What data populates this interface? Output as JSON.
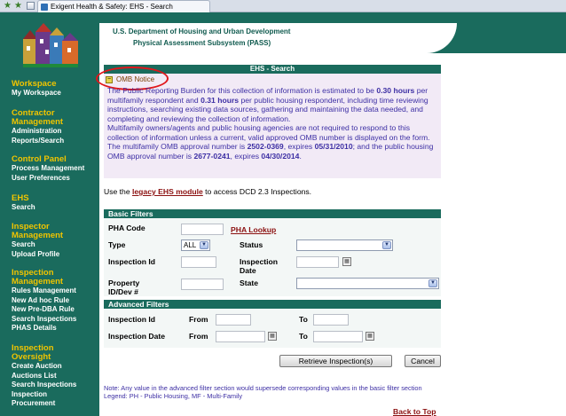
{
  "browser": {
    "tab_title": "Exigent Health & Safety: EHS - Search"
  },
  "header": {
    "line1": "U.S. Department of Housing and Urban Development",
    "line2": "Physical Assessment Subsystem (PASS)"
  },
  "sidebar": {
    "sections": [
      {
        "heading": "Workspace",
        "links": [
          "My Workspace"
        ]
      },
      {
        "heading": "Contractor Management",
        "links": [
          "Administration",
          "Reports/Search"
        ]
      },
      {
        "heading": "Control Panel",
        "links": [
          "Process Management",
          "User Preferences"
        ]
      },
      {
        "heading": "EHS",
        "links": [
          "Search"
        ]
      },
      {
        "heading": "Inspector Management",
        "links": [
          "Search",
          "Upload Profile"
        ]
      },
      {
        "heading": "Inspection Management",
        "links": [
          "Rules Management",
          "New Ad hoc Rule",
          "New Pre-DBA Rule",
          "Search Inspections",
          "PHAS Details"
        ]
      },
      {
        "heading": "Inspection Oversight",
        "links": [
          "Create Auction",
          "Auctions List",
          "Search Inspections",
          "Inspection Procurement"
        ]
      }
    ]
  },
  "page": {
    "title": "EHS - Search",
    "omb_toggle": "−",
    "omb_label": "OMB Notice",
    "omb": {
      "p1_a": "The Public Reporting Burden for this collection of information is estimated to be ",
      "p1_b": "0.30 hours",
      "p1_c": " per multifamily respondent and ",
      "p1_d": "0.31 hours",
      "p1_e": " per public housing respondent, including time reviewing instructions, searching existing data sources, gathering and maintaining the data needed, and completing and reviewing the collection of information.",
      "p2_a": "Multifamily owners/agents and public housing agencies are not required to respond to this collection of information unless a current, valid approved OMB number is displayed on the form. The multifamily OMB approval number is ",
      "p2_b": "2502-0369",
      "p2_c": ", expires ",
      "p2_d": "05/31/2010",
      "p2_e": "; and the public housing OMB approval number is ",
      "p2_f": "2677-0241",
      "p2_g": ", expires ",
      "p2_h": "04/30/2014",
      "p2_i": "."
    },
    "legacy_prefix": "Use the ",
    "legacy_link": "legacy EHS module",
    "legacy_suffix": " to access DCD 2.3 Inspections."
  },
  "basic_filters": {
    "title": "Basic Filters",
    "pha_code_label": "PHA Code",
    "pha_lookup_link": "PHA Lookup",
    "type_label": "Type",
    "type_value": "ALL",
    "status_label": "Status",
    "status_value": "",
    "inspection_id_label": "Inspection Id",
    "inspection_date_label": "Inspection Date",
    "property_label": "Property ID/Dev #",
    "state_label": "State",
    "state_value": ""
  },
  "advanced_filters": {
    "title": "Advanced Filters",
    "inspection_id_label": "Inspection Id",
    "inspection_date_label": "Inspection Date",
    "from_label": "From",
    "to_label": "To"
  },
  "buttons": {
    "retrieve": "Retrieve Inspection(s)",
    "cancel": "Cancel"
  },
  "footer": {
    "note": "Note: Any value in the advanced filter section would supersede corresponding values in the basic filter section",
    "legend": "Legend: PH - Public Housing, MF - Multi-Family",
    "back_to_top": "Back to Top"
  },
  "icons": {
    "dropdown": "chevron-down-icon",
    "calendar": "calendar-icon",
    "collapse": "collapse-toggle-icon",
    "logo": "houses-logo-icon"
  },
  "colors": {
    "primary_green": "#1a6b5d",
    "nav_heading": "#f0c400",
    "link_red": "#8b1010",
    "notice_text": "#3d2fa4",
    "highlight_circle": "#e0161b"
  }
}
